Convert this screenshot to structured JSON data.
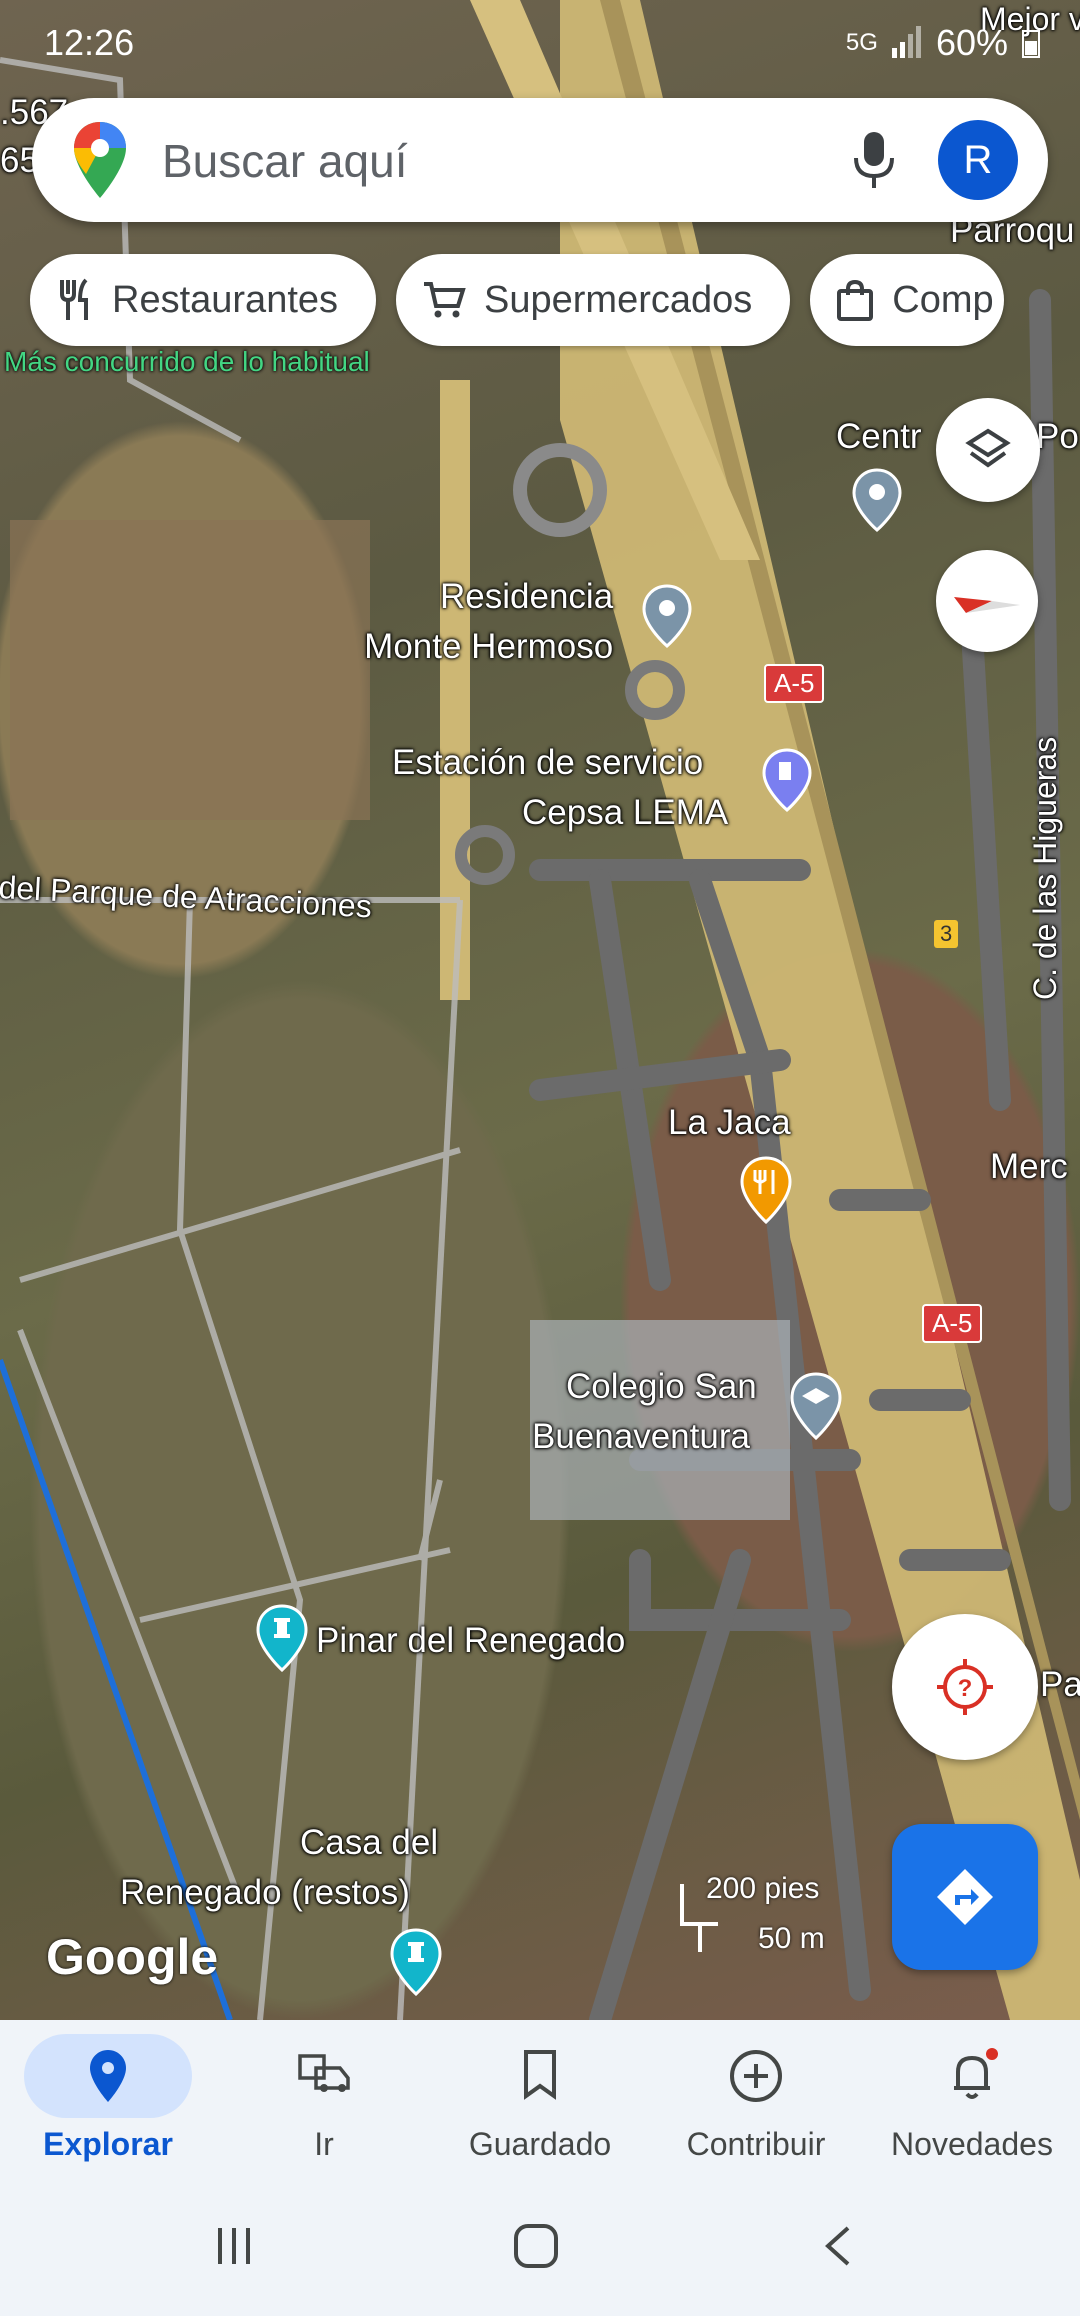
{
  "status": {
    "time": "12:26",
    "network": "5G",
    "battery": "60%"
  },
  "search": {
    "placeholder": "Buscar aquí",
    "avatar_letter": "R"
  },
  "chips": [
    {
      "icon": "fork-knife-icon",
      "label": "Restaurantes"
    },
    {
      "icon": "cart-icon",
      "label": "Supermercados"
    },
    {
      "icon": "shopping-bag-icon",
      "label": "Comp"
    }
  ],
  "map": {
    "busy_notice": "Más concurrido de lo habitual",
    "places": {
      "residencia": "Residencia\nMonte Hermoso",
      "estacion": "Estación de servicio\nCepsa LEMA",
      "parque": "del Parque de Atracciones",
      "lajaca": "La Jaca",
      "colegio": "Colegio San\nBuenaventura",
      "pinar": "Pinar del Renegado",
      "casa": "Casa del\nRenegado (restos)",
      "centro": "Centr",
      "po": "Po",
      "mejor": "Mejor v",
      "parroq": "Parroqu",
      "merc": "Merc",
      "pa": "Pa",
      "higueras": "C. de las Higueras"
    },
    "road_shields": {
      "a5_top": "A-5",
      "a5_bottom": "A-5",
      "exit_3": "3"
    },
    "scale": {
      "imperial": "200 pies",
      "metric": "50 m"
    },
    "attribution": "Google",
    "left_edge_numbers": [
      ".567",
      "65"
    ]
  },
  "nav": [
    {
      "label": "Explorar",
      "icon": "location-pin-icon",
      "active": true
    },
    {
      "label": "Ir",
      "icon": "car-icon",
      "active": false
    },
    {
      "label": "Guardado",
      "icon": "bookmark-icon",
      "active": false
    },
    {
      "label": "Contribuir",
      "icon": "add-circle-icon",
      "active": false
    },
    {
      "label": "Novedades",
      "icon": "bell-icon",
      "active": false,
      "badge": true
    }
  ],
  "colors": {
    "accent": "#1a73e8",
    "active_nav": "#0b57d0",
    "nav_bg": "#f0f4f9"
  }
}
